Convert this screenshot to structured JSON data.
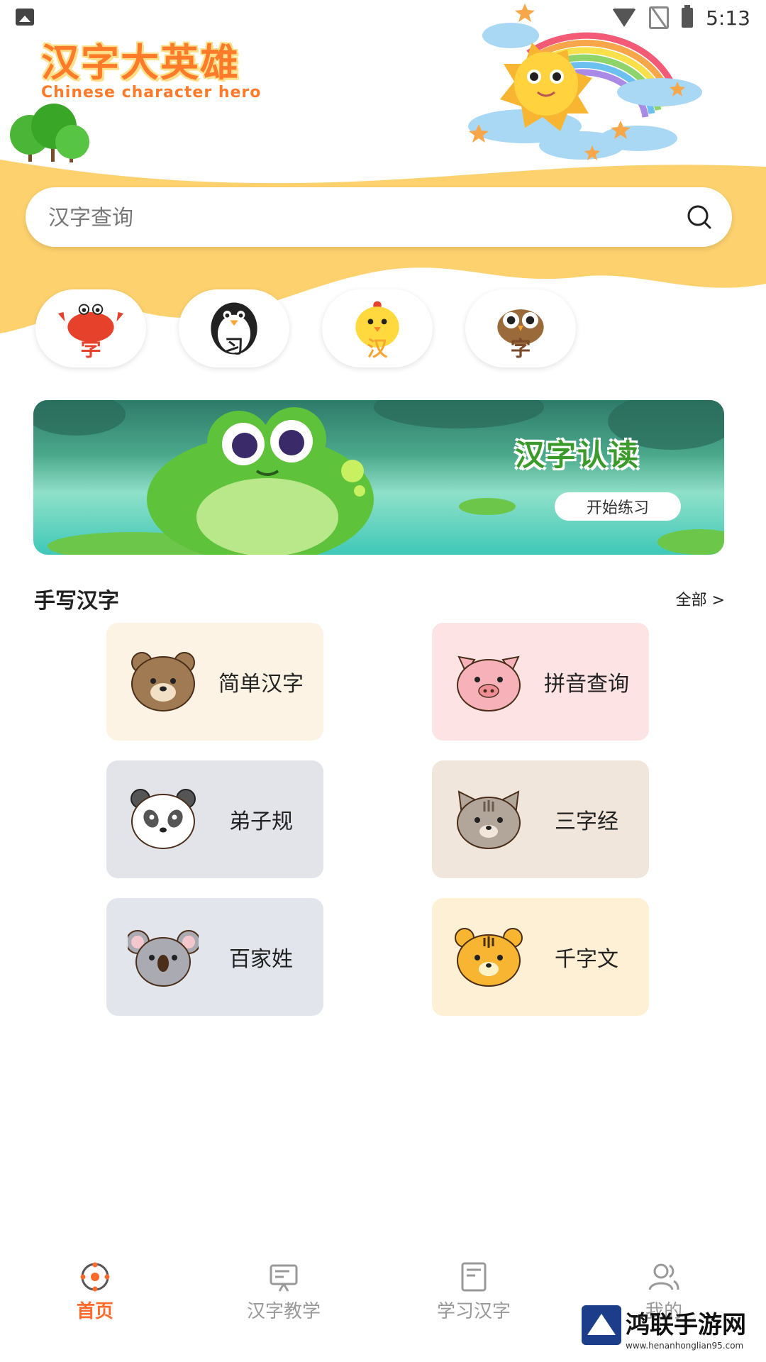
{
  "status_bar": {
    "time": "5:13"
  },
  "header": {
    "logo_title": "汉字大英雄",
    "logo_subtitle": "Chinese character hero"
  },
  "search": {
    "placeholder": "汉字查询",
    "value": ""
  },
  "categories": [
    {
      "char": "学",
      "animal": "crab"
    },
    {
      "char": "习",
      "animal": "penguin"
    },
    {
      "char": "汉",
      "animal": "chick"
    },
    {
      "char": "字",
      "animal": "owl"
    }
  ],
  "banner": {
    "title": "汉字认读",
    "button_label": "开始练习"
  },
  "section": {
    "title": "手写汉字",
    "more_label": "全部 >"
  },
  "cards": [
    {
      "label": "简单汉字",
      "animal": "bear",
      "bg": "#fdf3e5"
    },
    {
      "label": "拼音查询",
      "animal": "pig",
      "bg": "#fde3e3"
    },
    {
      "label": "弟子规",
      "animal": "panda",
      "bg": "#e3e3ea"
    },
    {
      "label": "三字经",
      "animal": "cat",
      "bg": "#f1e6dc"
    },
    {
      "label": "百家姓",
      "animal": "koala",
      "bg": "#e3e5ec"
    },
    {
      "label": "千字文",
      "animal": "tiger",
      "bg": "#fdf0d4"
    }
  ],
  "nav": [
    {
      "label": "首页",
      "icon": "home-icon",
      "active": true
    },
    {
      "label": "汉字教学",
      "icon": "teaching-board-icon",
      "active": false
    },
    {
      "label": "学习汉字",
      "icon": "document-icon",
      "active": false
    },
    {
      "label": "我的",
      "icon": "user-icon",
      "active": false
    }
  ],
  "watermark": {
    "title": "鸿联手游网",
    "url": "www.henanhonglian95.com"
  },
  "colors": {
    "accent": "#ff6a2a",
    "header_yellow": "#fdd26e",
    "banner_green": "#3a9a2a"
  }
}
